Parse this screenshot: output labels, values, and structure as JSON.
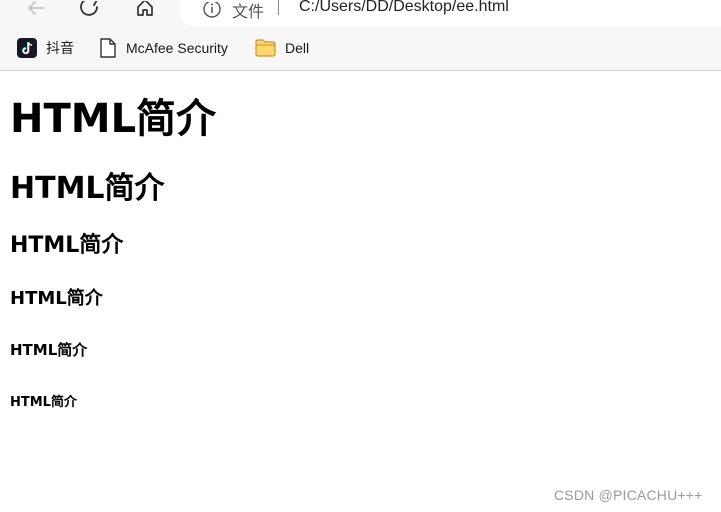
{
  "browser": {
    "address_label": "文件",
    "url": "C:/Users/DD/Desktop/ee.html",
    "icons": [
      "back-icon",
      "reload-icon",
      "home-icon",
      "info-icon"
    ]
  },
  "bookmarks": [
    {
      "label": "抖音",
      "icon": "douyin-icon"
    },
    {
      "label": "McAfee Security",
      "icon": "document-icon"
    },
    {
      "label": "Dell",
      "icon": "folder-icon"
    }
  ],
  "page": {
    "headings": [
      {
        "level": "h1",
        "text": "HTML简介"
      },
      {
        "level": "h2",
        "text": "HTML简介"
      },
      {
        "level": "h3",
        "text": "HTML简介"
      },
      {
        "level": "h4",
        "text": "HTML简介"
      },
      {
        "level": "h5",
        "text": "HTML简介"
      },
      {
        "level": "h6",
        "text": "HTML简介"
      }
    ]
  },
  "watermark": "CSDN @PICACHU+++"
}
